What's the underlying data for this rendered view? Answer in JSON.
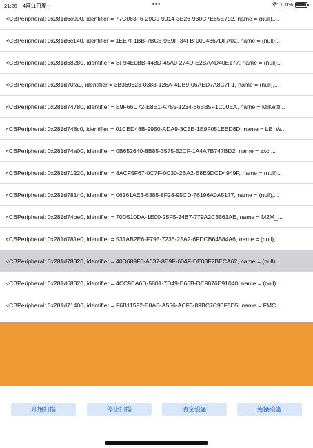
{
  "status_bar": {
    "time": "21:26",
    "date": "4月11日周一",
    "center_dots": "•••",
    "battery_percent": "100%"
  },
  "peripherals": [
    "<CBPeripheral: 0x281d6c000, identifier = 77C063F6-29C9-9014-3E26-930C7E85E792, name = (null),...",
    "<CBPeripheral: 0x281d6c140, identifier = 1EE7F1BB-7BC6-9E9F-34FB-0004867DFA02, name = (null),...",
    "<CBPeripheral: 0x281d68280, identifier = BF94E0BB-448D-45A0-274D-E2BAAD40E177, name = (null)...",
    "<CBPeripheral: 0x281d70fa0, identifier = 3B369623-0383-126A-4DB9-06AED7A8C7F1, name = (null),...",
    "<CBPeripheral: 0x281d74780, identifier = E9F66C72-E8E1-A755-1234-66BB5F1C00EA, name = MiKettl...",
    "<CBPeripheral: 0x281d748c0, identifier = 01CED48B-9950-ADA9-3C5E-1E9F051EED8D, name = LE_W...",
    "<CBPeripheral: 0x281d74a00, identifier = 0B652640-8B85-3575-52CF-1A4A7B747BD2, name = zxc,...",
    "<CBPeripheral: 0x281d71220, identifier = 8ACF5F67-0C7F-0C30-2BA2-E8E9DCD4949F, name = (null)...",
    "<CBPeripheral: 0x281d78140, identifier = 06161AE3-6385-8F28-95CD-76196A0A5177, name = (null),...",
    "<CBPeripheral: 0x281d74be0, identifier = 70D510DA-1E00-25F5-24B7-779A2C3561AE, name = M2M_...",
    "<CBPeripheral: 0x281d781e0, identifier = 531AB2E6-F795-7236-25A2-6FDCB64584A6, name = (null),...",
    "<CBPeripheral: 0x281d78320, identifier = 40D689F6-A037-8E9F-604F-DE03F2BECA62, name = (null)...",
    "<CBPeripheral: 0x281d68320, identifier = 4CC9EA6D-5801-7D49-E66B-DE9876E91040, name = (null)...",
    "<CBPeripheral: 0x281d71400, identifier = F6B11592-E8AB-A556-ACF3-89BC7C90F5D5, name = FMC..."
  ],
  "selected_index": 11,
  "buttons": {
    "start_scan": "开始扫描",
    "stop_scan": "停止扫描",
    "clear_devices": "清空设备",
    "connect_device": "连接设备"
  },
  "colors": {
    "panel": "#ef9a35",
    "button_bg": "#dae7f8",
    "button_text": "#2b6fd6",
    "selected_row": "#d1d1d6"
  }
}
